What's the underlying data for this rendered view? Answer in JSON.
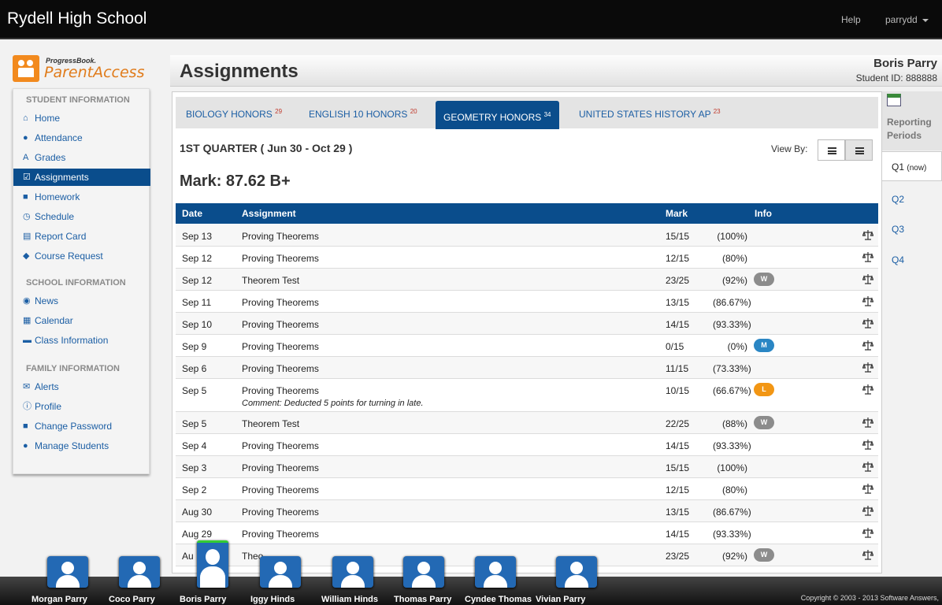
{
  "header": {
    "school_name": "Rydell High School",
    "help": "Help",
    "user": "parrydd"
  },
  "logo": {
    "small": "ProgressBook.",
    "big": "ParentAccess"
  },
  "sidebar": {
    "student_heading": "STUDENT INFORMATION",
    "student_items": [
      "Home",
      "Attendance",
      "Grades",
      "Assignments",
      "Homework",
      "Schedule",
      "Report Card",
      "Course Request"
    ],
    "school_heading": "SCHOOL INFORMATION",
    "school_items": [
      "News",
      "Calendar",
      "Class Information"
    ],
    "family_heading": "FAMILY INFORMATION",
    "family_items": [
      "Alerts",
      "Profile",
      "Change Password",
      "Manage Students"
    ],
    "active": "Assignments"
  },
  "page": {
    "title": "Assignments",
    "student_name": "Boris Parry",
    "student_id": "Student ID: 888888"
  },
  "tabs": [
    {
      "label": "BIOLOGY HONORS",
      "count": "29"
    },
    {
      "label": "ENGLISH 10 HONORS",
      "count": "20"
    },
    {
      "label": "GEOMETRY HONORS",
      "count": "34"
    },
    {
      "label": "UNITED STATES HISTORY AP",
      "count": "23"
    }
  ],
  "active_tab": "GEOMETRY HONORS",
  "quarter": "1ST QUARTER ( Jun 30 - Oct 29 )",
  "view_by": "View By:",
  "mark": "Mark: 87.62 B+",
  "table": {
    "headers": {
      "date": "Date",
      "assignment": "Assignment",
      "mark": "Mark",
      "info": "Info"
    },
    "rows": [
      {
        "date": "Sep 13",
        "assignment": "Proving Theorems",
        "score": "15/15",
        "pct": "(100%)",
        "badge": ""
      },
      {
        "date": "Sep 12",
        "assignment": "Proving Theorems",
        "score": "12/15",
        "pct": "(80%)",
        "badge": ""
      },
      {
        "date": "Sep 12",
        "assignment": "Theorem Test",
        "score": "23/25",
        "pct": "(92%)",
        "badge": "W"
      },
      {
        "date": "Sep 11",
        "assignment": "Proving Theorems",
        "score": "13/15",
        "pct": "(86.67%)",
        "badge": ""
      },
      {
        "date": "Sep 10",
        "assignment": "Proving Theorems",
        "score": "14/15",
        "pct": "(93.33%)",
        "badge": ""
      },
      {
        "date": "Sep 9",
        "assignment": "Proving Theorems",
        "score": "0/15",
        "pct": "(0%)",
        "badge": "M"
      },
      {
        "date": "Sep 6",
        "assignment": "Proving Theorems",
        "score": "11/15",
        "pct": "(73.33%)",
        "badge": ""
      },
      {
        "date": "Sep 5",
        "assignment": "Proving Theorems",
        "score": "10/15",
        "pct": "(66.67%)",
        "badge": "L",
        "comment": "Comment: Deducted 5 points for turning in late."
      },
      {
        "date": "Sep 5",
        "assignment": "Theorem Test",
        "score": "22/25",
        "pct": "(88%)",
        "badge": "W"
      },
      {
        "date": "Sep 4",
        "assignment": "Proving Theorems",
        "score": "14/15",
        "pct": "(93.33%)",
        "badge": ""
      },
      {
        "date": "Sep 3",
        "assignment": "Proving Theorems",
        "score": "15/15",
        "pct": "(100%)",
        "badge": ""
      },
      {
        "date": "Sep 2",
        "assignment": "Proving Theorems",
        "score": "12/15",
        "pct": "(80%)",
        "badge": ""
      },
      {
        "date": "Aug 30",
        "assignment": "Proving Theorems",
        "score": "13/15",
        "pct": "(86.67%)",
        "badge": ""
      },
      {
        "date": "Aug 29",
        "assignment": "Proving Theorems",
        "score": "14/15",
        "pct": "(93.33%)",
        "badge": ""
      },
      {
        "date": "Au",
        "assignment": "Theo",
        "score": "23/25",
        "pct": "(92%)",
        "badge": "W"
      }
    ]
  },
  "reporting_periods": {
    "label_1": "Reporting",
    "label_2": "Periods",
    "periods": [
      "Q1",
      "Q2",
      "Q3",
      "Q4"
    ],
    "active_note": "(now)"
  },
  "students": [
    "Morgan Parry",
    "Coco Parry",
    "Boris Parry",
    "Iggy Hinds",
    "William Hinds",
    "Thomas Parry",
    "Cyndee Thomas",
    "Vivian Parry"
  ],
  "selected_student": "Boris Parry",
  "copyright": "Copyright © 2003 - 2013 Software Answers,",
  "colors": {
    "primary": "#0a4d8c",
    "link": "#1b5ea4",
    "brand_orange": "#f28a1e"
  }
}
